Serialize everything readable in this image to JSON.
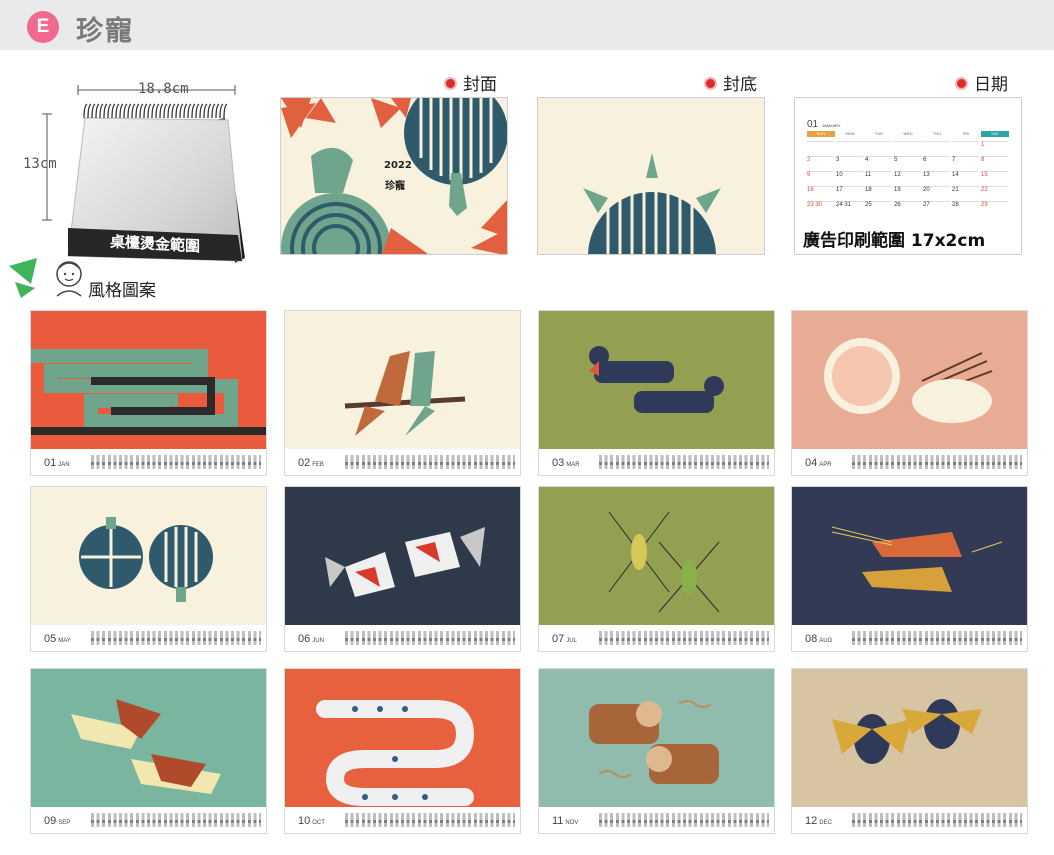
{
  "header": {
    "badge": "E",
    "title": "珍寵"
  },
  "desk": {
    "width_label": "18.8cm",
    "height_label": "13cm",
    "brand_text": "桌檯燙金範圍"
  },
  "previews": {
    "cover": {
      "label": "封面",
      "year": "2022",
      "title": "珍寵"
    },
    "back": {
      "label": "封底"
    },
    "date": {
      "label": "日期",
      "month_num": "01",
      "month_name": "JANUARY",
      "ad_range": "廣告印刷範圍 17x2cm",
      "weekdays": [
        "SUN",
        "MON",
        "TUE",
        "WED",
        "THU",
        "FRI",
        "SAT"
      ],
      "rows": [
        [
          "",
          "",
          "",
          "",
          "",
          "",
          "1"
        ],
        [
          "2",
          "3",
          "4",
          "5",
          "6",
          "7",
          "8"
        ],
        [
          "9",
          "10",
          "11",
          "12",
          "13",
          "14",
          "15"
        ],
        [
          "16",
          "17",
          "18",
          "19",
          "20",
          "21",
          "22"
        ],
        [
          "23 30",
          "24 31",
          "25",
          "26",
          "27",
          "28",
          "29"
        ]
      ]
    }
  },
  "style_label": "風格圖案",
  "months": [
    {
      "num": "01",
      "name": "JAN",
      "bg": "#ea5a3c"
    },
    {
      "num": "02",
      "name": "FEB",
      "bg": "#f7f1dd"
    },
    {
      "num": "03",
      "name": "MAR",
      "bg": "#93a052"
    },
    {
      "num": "04",
      "name": "APR",
      "bg": "#e8ab93"
    },
    {
      "num": "05",
      "name": "MAY",
      "bg": "#f7f1dd"
    },
    {
      "num": "06",
      "name": "JUN",
      "bg": "#2e3a49"
    },
    {
      "num": "07",
      "name": "JUL",
      "bg": "#93a052"
    },
    {
      "num": "08",
      "name": "AUG",
      "bg": "#333a56"
    },
    {
      "num": "09",
      "name": "SEP",
      "bg": "#79b59f"
    },
    {
      "num": "10",
      "name": "OCT",
      "bg": "#e8613f"
    },
    {
      "num": "11",
      "name": "NOV",
      "bg": "#8fbcac"
    },
    {
      "num": "12",
      "name": "DEC",
      "bg": "#d6c4a2"
    }
  ],
  "colors": {
    "accent": "#ef6a8d",
    "dot": "#d82d2d",
    "teal": "#2f5a6b",
    "green": "#6fa58c"
  }
}
